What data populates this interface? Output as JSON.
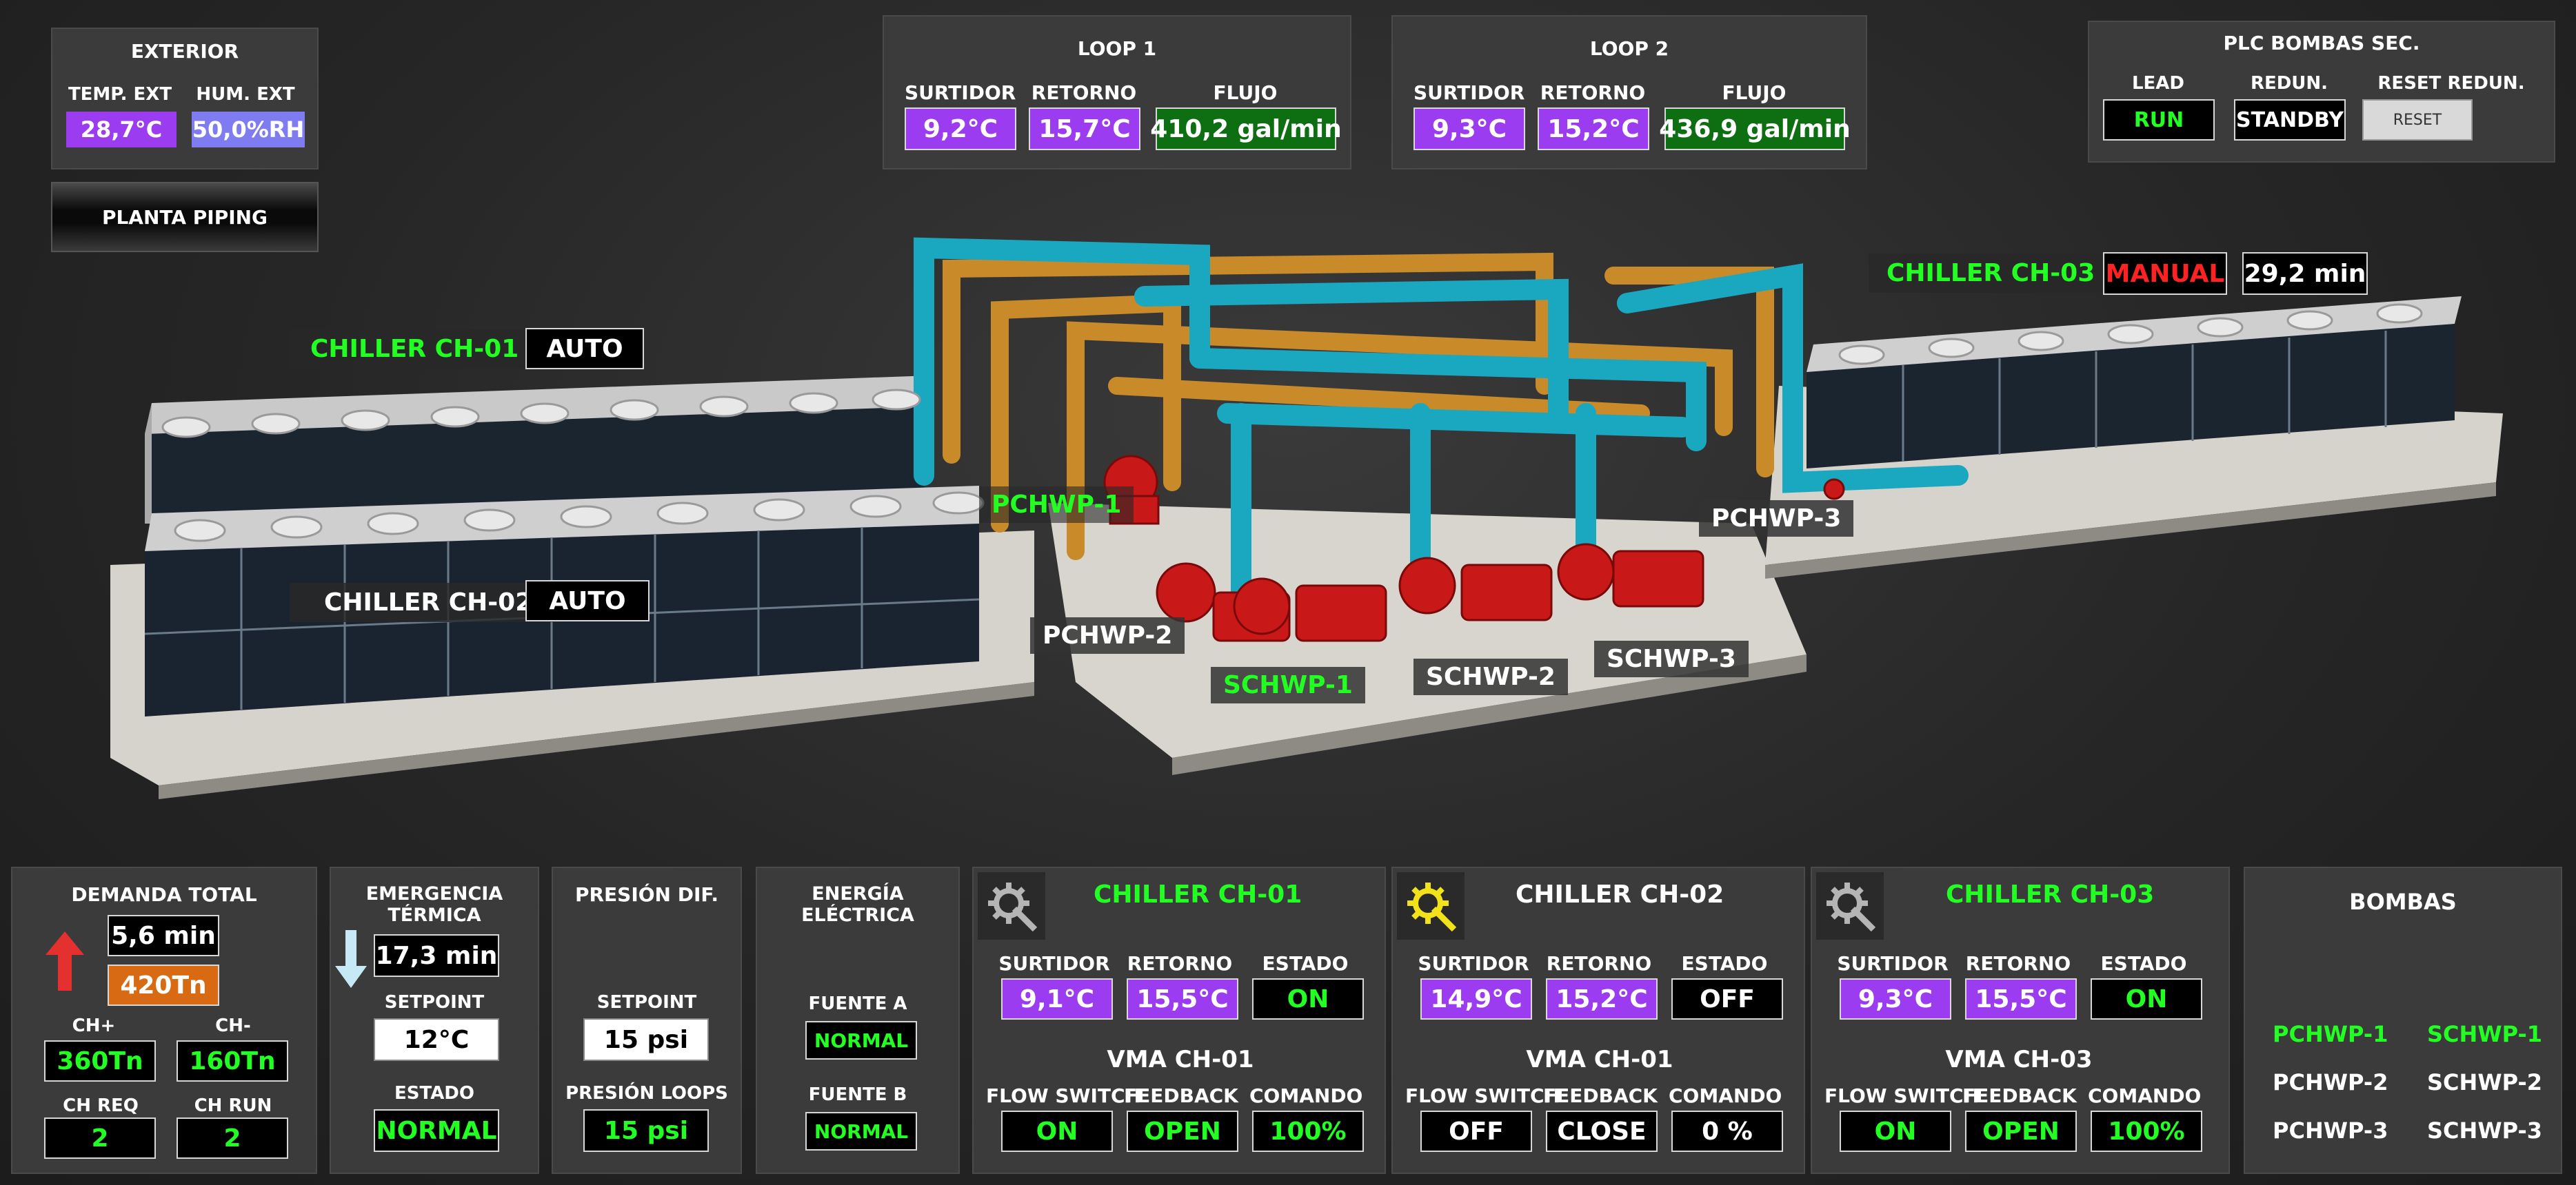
{
  "exterior": {
    "title": "EXTERIOR",
    "temp_label": "TEMP. EXT",
    "hum_label": "HUM. EXT",
    "temp": "28,7°C",
    "hum": "50,0%RH"
  },
  "nav": {
    "planta_piping": "PLANTA PIPING"
  },
  "loop1": {
    "title": "LOOP 1",
    "surtidor_label": "SURTIDOR",
    "retorno_label": "RETORNO",
    "flujo_label": "FLUJO",
    "surtidor": "9,2°C",
    "retorno": "15,7°C",
    "flujo": "410,2 gal/min"
  },
  "loop2": {
    "title": "LOOP 2",
    "surtidor_label": "SURTIDOR",
    "retorno_label": "RETORNO",
    "flujo_label": "FLUJO",
    "surtidor": "9,3°C",
    "retorno": "15,2°C",
    "flujo": "436,9 gal/min"
  },
  "plc": {
    "title": "PLC BOMBAS SEC.",
    "lead_label": "LEAD",
    "redun_label": "REDUN.",
    "reset_label": "RESET REDUN.",
    "lead": "RUN",
    "redun": "STANDBY",
    "reset_button": "RESET"
  },
  "scene": {
    "ch01": {
      "name": "CHILLER CH-01",
      "mode": "AUTO"
    },
    "ch02": {
      "name": "CHILLER CH-02",
      "mode": "AUTO"
    },
    "ch03": {
      "name": "CHILLER CH-03",
      "mode": "MANUAL",
      "timer": "29,2 min"
    },
    "pumps": {
      "pchwp1": "PCHWP-1",
      "pchwp2": "PCHWP-2",
      "pchwp3": "PCHWP-3",
      "schwp1": "SCHWP-1",
      "schwp2": "SCHWP-2",
      "schwp3": "SCHWP-3"
    }
  },
  "demanda": {
    "title": "DEMANDA TOTAL",
    "time": "5,6 min",
    "tons": "420Tn",
    "chp_label": "CH+",
    "chm_label": "CH-",
    "chp": "360Tn",
    "chm": "160Tn",
    "chreq_label": "CH REQ",
    "chrun_label": "CH RUN",
    "chreq": "2",
    "chrun": "2"
  },
  "emergencia": {
    "title": "EMERGENCIA TÉRMICA",
    "time": "17,3 min",
    "setpoint_label": "SETPOINT",
    "setpoint": "12°C",
    "estado_label": "ESTADO",
    "estado": "NORMAL"
  },
  "presion": {
    "title": "PRESIÓN DIF.",
    "setpoint_label": "SETPOINT",
    "setpoint": "15 psi",
    "loops_label": "PRESIÓN LOOPS",
    "loops": "15 psi"
  },
  "energia": {
    "title": "ENERGÍA ELÉCTRICA",
    "fuente_a_label": "FUENTE A",
    "fuente_a": "NORMAL",
    "fuente_b_label": "FUENTE B",
    "fuente_b": "NORMAL"
  },
  "chillers": [
    {
      "name": "CHILLER CH-01",
      "surtidor_label": "SURTIDOR",
      "retorno_label": "RETORNO",
      "estado_label": "ESTADO",
      "surtidor": "9,1°C",
      "retorno": "15,5°C",
      "estado": "ON",
      "vma": "VMA CH-01",
      "flow_label": "FLOW SWITCH",
      "feedback_label": "FEEDBACK",
      "comando_label": "COMANDO",
      "flow": "ON",
      "feedback": "OPEN",
      "comando": "100%"
    },
    {
      "name": "CHILLER CH-02",
      "surtidor_label": "SURTIDOR",
      "retorno_label": "RETORNO",
      "estado_label": "ESTADO",
      "surtidor": "14,9°C",
      "retorno": "15,2°C",
      "estado": "OFF",
      "vma": "VMA CH-01",
      "flow_label": "FLOW SWITCH",
      "feedback_label": "FEEDBACK",
      "comando_label": "COMANDO",
      "flow": "OFF",
      "feedback": "CLOSE",
      "comando": "0 %"
    },
    {
      "name": "CHILLER CH-03",
      "surtidor_label": "SURTIDOR",
      "retorno_label": "RETORNO",
      "estado_label": "ESTADO",
      "surtidor": "9,3°C",
      "retorno": "15,5°C",
      "estado": "ON",
      "vma": "VMA CH-03",
      "flow_label": "FLOW SWITCH",
      "feedback_label": "FEEDBACK",
      "comando_label": "COMANDO",
      "flow": "ON",
      "feedback": "OPEN",
      "comando": "100%"
    }
  ],
  "bombas": {
    "title": "BOMBAS",
    "p1": "PCHWP-1",
    "p2": "PCHWP-2",
    "p3": "PCHWP-3",
    "s1": "SCHWP-1",
    "s2": "SCHWP-2",
    "s3": "SCHWP-3"
  },
  "colors": {
    "active_green": "#22ff22",
    "alarm_red": "#ff2222",
    "purple": "#9b3cf0",
    "pipe_cyan": "#1aa7c0",
    "pipe_orange": "#c98a2a",
    "pump_red": "#c81818"
  }
}
